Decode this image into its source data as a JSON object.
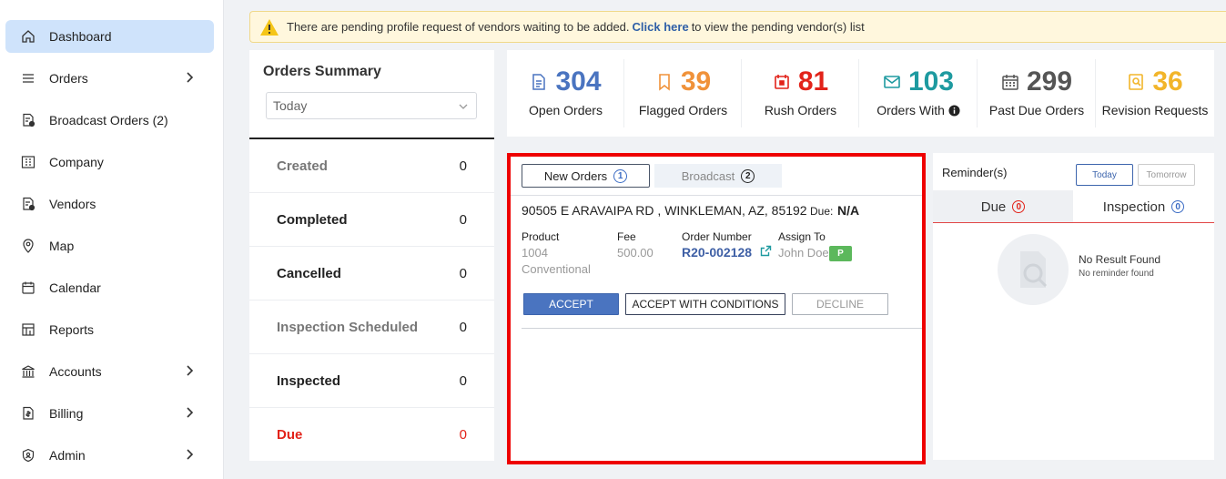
{
  "sidebar": {
    "items": [
      {
        "label": "Dashboard",
        "icon": "home-icon",
        "active": true
      },
      {
        "label": "Orders",
        "icon": "list-icon",
        "has_chevron": true
      },
      {
        "label": "Broadcast Orders (2)",
        "icon": "broadcast-doc-icon"
      },
      {
        "label": "Company",
        "icon": "company-icon"
      },
      {
        "label": "Vendors",
        "icon": "vendor-doc-icon"
      },
      {
        "label": "Map",
        "icon": "map-pin-icon"
      },
      {
        "label": "Calendar",
        "icon": "calendar-icon"
      },
      {
        "label": "Reports",
        "icon": "reports-icon"
      },
      {
        "label": "Accounts",
        "icon": "bank-icon",
        "has_chevron": true
      },
      {
        "label": "Billing",
        "icon": "billing-icon",
        "has_chevron": true
      },
      {
        "label": "Admin",
        "icon": "shield-icon",
        "has_chevron": true
      }
    ]
  },
  "alert": {
    "text_before": "There are pending profile request of vendors waiting to be added.",
    "link": "Click here",
    "text_after": "to view the pending vendor(s) list"
  },
  "summary": {
    "title": "Orders Summary",
    "period": "Today",
    "rows": [
      {
        "name": "Created",
        "count": "0",
        "style": "muted"
      },
      {
        "name": "Completed",
        "count": "0",
        "style": "dark"
      },
      {
        "name": "Cancelled",
        "count": "0",
        "style": "dark"
      },
      {
        "name": "Inspection Scheduled",
        "count": "0",
        "style": "muted"
      },
      {
        "name": "Inspected",
        "count": "0",
        "style": "dark"
      },
      {
        "name": "Due",
        "count": "0",
        "style": "red"
      }
    ]
  },
  "stats": [
    {
      "value": "304",
      "label": "Open Orders",
      "color": "#4a74c0",
      "icon": "document-icon"
    },
    {
      "value": "39",
      "label": "Flagged Orders",
      "color": "#f0923a",
      "icon": "bookmark-icon"
    },
    {
      "value": "81",
      "label": "Rush Orders",
      "color": "#e2231a",
      "icon": "rush-calendar-icon"
    },
    {
      "value": "103",
      "label": "Orders With",
      "color": "#1e9aa0",
      "icon": "envelope-icon",
      "info": true
    },
    {
      "value": "299",
      "label": "Past Due Orders",
      "color": "#555555",
      "icon": "calendar-grid-icon"
    },
    {
      "value": "36",
      "label": "Revision Requests",
      "color": "#f2b52a",
      "icon": "revision-icon"
    }
  ],
  "order_panel": {
    "tab_new": "New Orders",
    "tab_new_count": "1",
    "tab_broadcast": "Broadcast",
    "tab_broadcast_count": "2",
    "address": "90505 E ARAVAIPA RD , WINKLEMAN, AZ, 85192",
    "due_label": "Due:",
    "due_value": "N/A",
    "product_label": "Product",
    "product_value_1": "1004",
    "product_value_2": "Conventional",
    "fee_label": "Fee",
    "fee_value": "500.00",
    "order_number_label": "Order Number",
    "order_number": "R20-002128",
    "assign_label": "Assign To",
    "assign_value": "John Doe",
    "badge": "P",
    "accept": "ACCEPT",
    "accept_conditions": "ACCEPT WITH CONDITIONS",
    "decline": "DECLINE"
  },
  "reminders": {
    "title": "Reminder(s)",
    "today": "Today",
    "tomorrow": "Tomorrow",
    "tab_due": "Due",
    "tab_due_count": "0",
    "tab_inspection": "Inspection",
    "tab_inspection_count": "0",
    "empty_title": "No Result Found",
    "empty_sub": "No reminder found"
  }
}
